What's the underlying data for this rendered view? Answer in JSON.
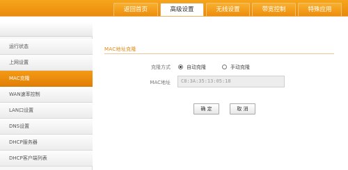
{
  "top_nav": {
    "tabs": [
      {
        "label": "返回首页",
        "active": false
      },
      {
        "label": "高级设置",
        "active": true
      },
      {
        "label": "无线设置",
        "active": false
      },
      {
        "label": "带宽控制",
        "active": false
      },
      {
        "label": "特殊应用",
        "active": false
      }
    ]
  },
  "sidebar": {
    "items": [
      {
        "label": "运行状态",
        "active": false
      },
      {
        "label": "上网设置",
        "active": false
      },
      {
        "label": "MAC克隆",
        "active": true
      },
      {
        "label": "WAN速率控制",
        "active": false
      },
      {
        "label": "LAN口设置",
        "active": false
      },
      {
        "label": "DNS设置",
        "active": false
      },
      {
        "label": "DHCP服务器",
        "active": false
      },
      {
        "label": "DHCP客户端列表",
        "active": false
      }
    ]
  },
  "main": {
    "section_title": "MAC地址克隆",
    "clone_mode": {
      "label": "克隆方式",
      "options": [
        {
          "label": "自动克隆",
          "checked": true
        },
        {
          "label": "手动克隆",
          "checked": false
        }
      ]
    },
    "mac_address": {
      "label": "MAC地址",
      "value": "C8:3A:35:13:05:18"
    },
    "buttons": {
      "confirm": "确 定",
      "cancel": "取 消"
    }
  },
  "colors": {
    "accent": "#f08c0a",
    "header_bg": "#f7a51d",
    "section_title": "#e0870f"
  }
}
